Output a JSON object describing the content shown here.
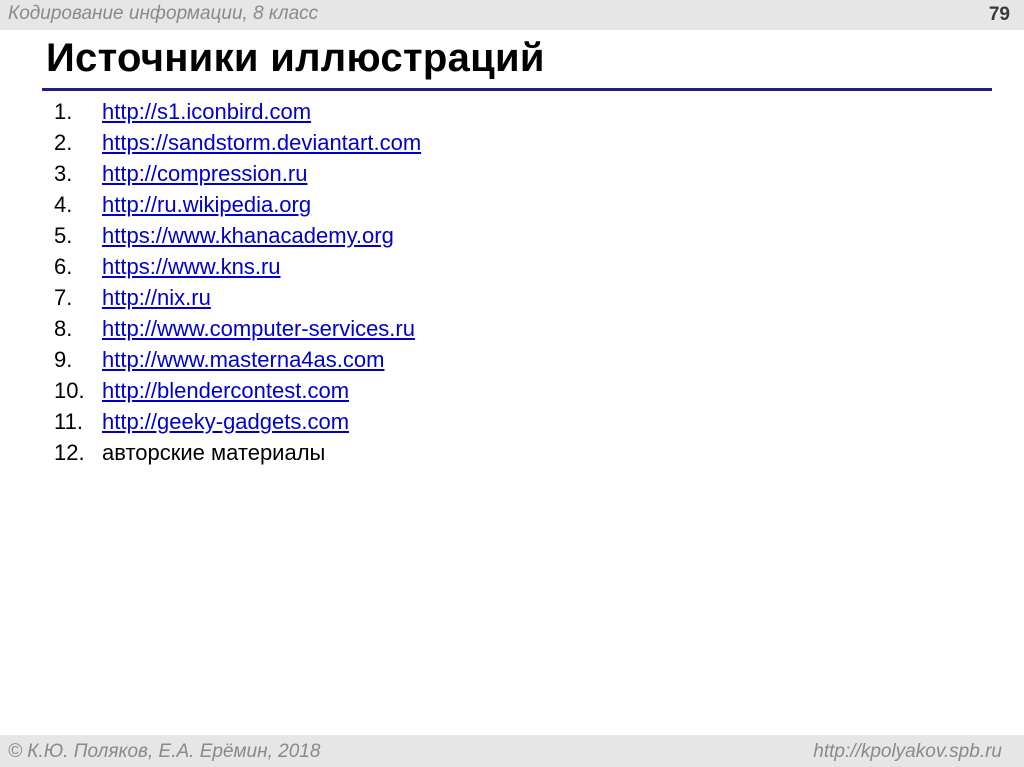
{
  "header": {
    "course": "Кодирование информации, 8 класс",
    "slide_number": "79"
  },
  "title": "Источники иллюстраций",
  "colors": {
    "link": "#0000cc",
    "underline": "#1f1f8c",
    "bar": "#e6e6e6",
    "muted_text": "#8a8a8a"
  },
  "sources": [
    {
      "num": "1.",
      "text": "http://s1.iconbird.com",
      "is_link": true
    },
    {
      "num": "2.",
      "text": "https://sandstorm.deviantart.com",
      "is_link": true
    },
    {
      "num": "3.",
      "text": "http://compression.ru",
      "is_link": true
    },
    {
      "num": "4.",
      "text": "http://ru.wikipedia.org",
      "is_link": true
    },
    {
      "num": "5.",
      "text": "https://www.khanacademy.org",
      "is_link": true
    },
    {
      "num": "6.",
      "text": "https://www.kns.ru",
      "is_link": true
    },
    {
      "num": "7.",
      "text": "http://nix.ru",
      "is_link": true
    },
    {
      "num": "8.",
      "text": "http://www.computer-services.ru",
      "is_link": true
    },
    {
      "num": "9.",
      "text": "http://www.masterna4as.com",
      "is_link": true
    },
    {
      "num": "10.",
      "text": "http://blendercontest.com",
      "is_link": true
    },
    {
      "num": "11.",
      "text": "http://geeky-gadgets.com",
      "is_link": true
    },
    {
      "num": "12.",
      "text": "авторские материалы",
      "is_link": false
    }
  ],
  "footer": {
    "copyright": "© К.Ю. Поляков, Е.А. Ерёмин, 2018",
    "site": "http://kpolyakov.spb.ru"
  }
}
